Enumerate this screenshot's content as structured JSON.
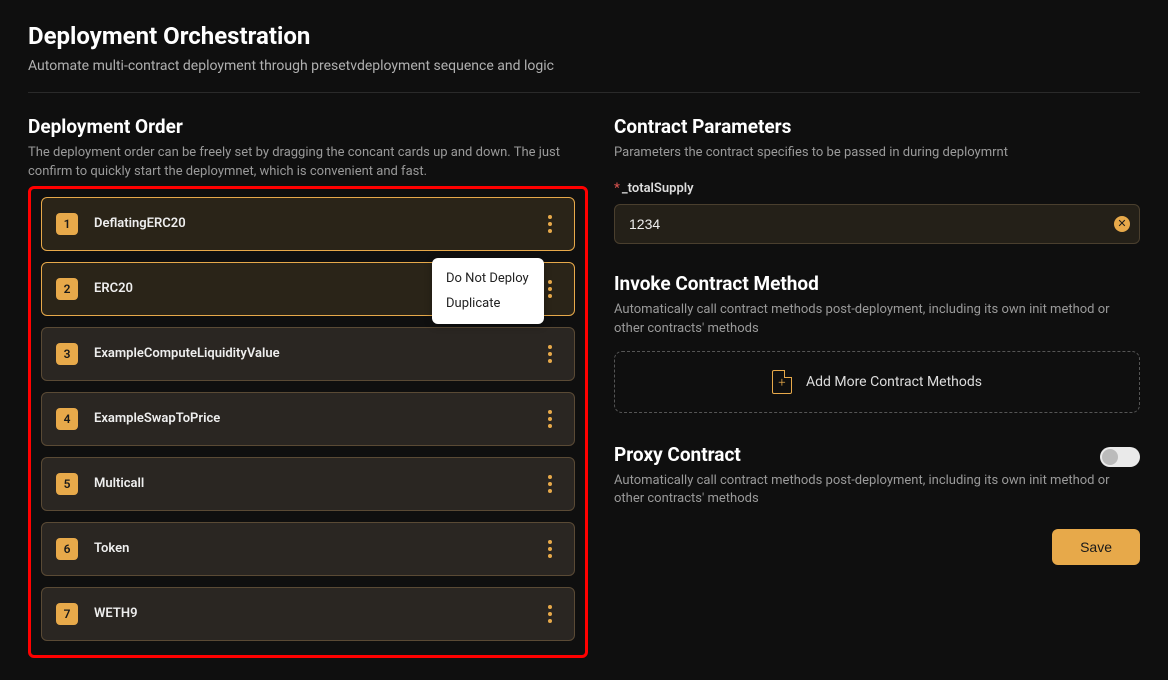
{
  "header": {
    "title": "Deployment Orchestration",
    "subtitle": "Automate multi-contract deployment through presetvdeployment sequence and logic"
  },
  "leftPanel": {
    "title": "Deployment Order",
    "desc": "The deployment order can be freely set by dragging the concant cards up and down. The just confirm to quickly start the deploymnet, which is convenient and fast.",
    "items": [
      {
        "num": "1",
        "name": "DeflatingERC20",
        "selected": true,
        "showMenu": false
      },
      {
        "num": "2",
        "name": "ERC20",
        "selected": true,
        "showMenu": true
      },
      {
        "num": "3",
        "name": "ExampleComputeLiquidityValue",
        "selected": false,
        "showMenu": false
      },
      {
        "num": "4",
        "name": "ExampleSwapToPrice",
        "selected": false,
        "showMenu": false
      },
      {
        "num": "5",
        "name": "Multicall",
        "selected": false,
        "showMenu": false
      },
      {
        "num": "6",
        "name": "Token",
        "selected": false,
        "showMenu": false
      },
      {
        "num": "7",
        "name": "WETH9",
        "selected": false,
        "showMenu": false
      }
    ],
    "menu": {
      "doNotDeploy": "Do Not Deploy",
      "duplicate": "Duplicate"
    }
  },
  "rightPanel": {
    "paramsTitle": "Contract Parameters",
    "paramsDesc": "Parameters the contract specifies to be passed in during deploymrnt",
    "param": {
      "required": "*",
      "name": "_totalSupply",
      "value": "1234"
    },
    "invokeTitle": "Invoke Contract Method",
    "invokeDesc": "Automatically call contract methods post-deployment, including its own init method or other contracts' methods",
    "addMethodsLabel": "Add More Contract Methods",
    "proxyTitle": "Proxy Contract",
    "proxyDesc": "Automatically call contract methods post-deployment, including its own init method or other contracts' methods",
    "saveLabel": "Save"
  }
}
